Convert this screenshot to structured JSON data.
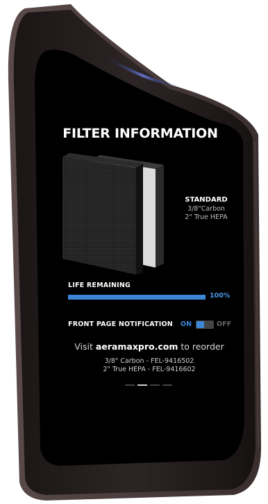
{
  "screen": {
    "title": "FILTER INFORMATION",
    "filter": {
      "type": "STANDARD",
      "line1": "3/8\"Carbon",
      "line2": "2\" True HEPA"
    },
    "life": {
      "label": "LIFE REMAINING",
      "percent_text": "100%",
      "fraction": 1.0
    },
    "notification": {
      "label": "FRONT PAGE NOTIFICATION",
      "on_label": "ON",
      "off_label": "OFF",
      "state": "on"
    },
    "reorder": {
      "prefix": "Visit ",
      "site": "aeramaxpro.com",
      "suffix": " to reorder",
      "part1": "3/8\" Carbon - FEL-9416502",
      "part2": "2\" True HEPA - FEL-9416602"
    },
    "pager": {
      "count": 4,
      "active": 1
    }
  },
  "colors": {
    "accent": "#3b86d6",
    "screen_bg": "#000000",
    "frame": "#2a2222"
  }
}
